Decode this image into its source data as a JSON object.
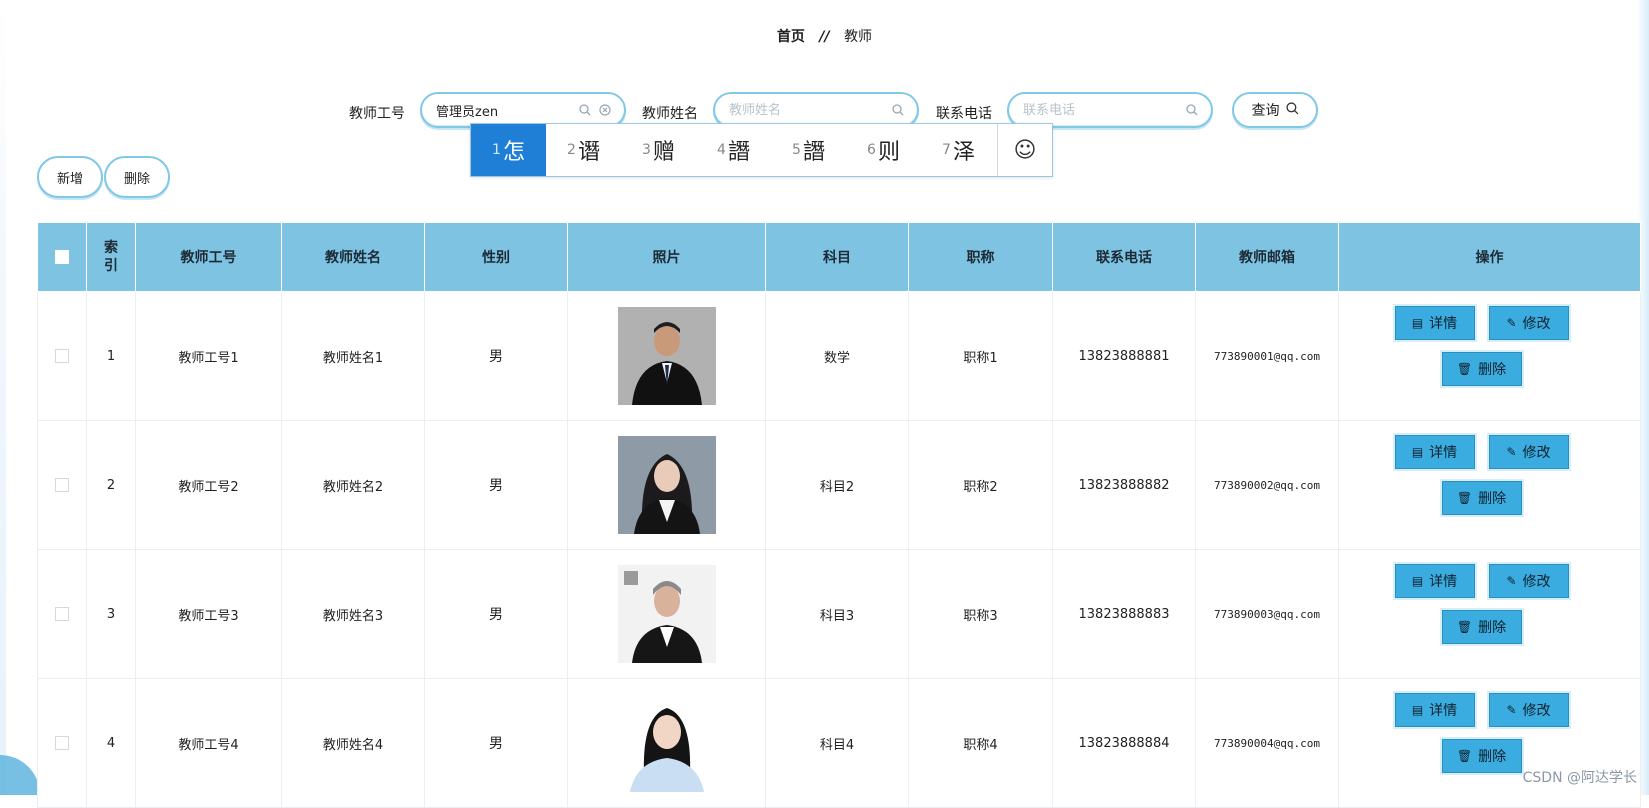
{
  "breadcrumb": {
    "home": "首页",
    "separator": "//",
    "current": "教师"
  },
  "search": {
    "teacher_no": {
      "label": "教师工号",
      "value": "管理员zen",
      "placeholder": ""
    },
    "teacher_name": {
      "label": "教师姓名",
      "value": "",
      "placeholder": "教师姓名"
    },
    "phone": {
      "label": "联系电话",
      "value": "",
      "placeholder": "联系电话"
    },
    "query_label": "查询"
  },
  "ime": {
    "candidates": [
      {
        "num": "1",
        "char": "怎"
      },
      {
        "num": "2",
        "char": "谮"
      },
      {
        "num": "3",
        "char": "赠"
      },
      {
        "num": "4",
        "char": "譖"
      },
      {
        "num": "5",
        "char": "譖"
      },
      {
        "num": "6",
        "char": "则"
      },
      {
        "num": "7",
        "char": "泽"
      }
    ],
    "emoji": "☺"
  },
  "actions": {
    "add": "新增",
    "delete": "删除"
  },
  "table": {
    "headers": [
      "索引",
      "教师工号",
      "教师姓名",
      "性别",
      "照片",
      "科目",
      "职称",
      "联系电话",
      "教师邮箱",
      "操作"
    ],
    "index_header_lines": [
      "索",
      "引"
    ],
    "rows": [
      {
        "index": "1",
        "teacher_no": "教师工号1",
        "name": "教师姓名1",
        "gender": "男",
        "subject": "数学",
        "title": "职称1",
        "phone": "13823888881",
        "email": "773890001@qq.com"
      },
      {
        "index": "2",
        "teacher_no": "教师工号2",
        "name": "教师姓名2",
        "gender": "男",
        "subject": "科目2",
        "title": "职称2",
        "phone": "13823888882",
        "email": "773890002@qq.com"
      },
      {
        "index": "3",
        "teacher_no": "教师工号3",
        "name": "教师姓名3",
        "gender": "男",
        "subject": "科目3",
        "title": "职称3",
        "phone": "13823888883",
        "email": "773890003@qq.com"
      },
      {
        "index": "4",
        "teacher_no": "教师工号4",
        "name": "教师姓名4",
        "gender": "男",
        "subject": "科目4",
        "title": "职称4",
        "phone": "13823888884",
        "email": "773890004@qq.com"
      }
    ],
    "row_actions": {
      "detail": "详情",
      "edit": "修改",
      "delete": "删除"
    }
  },
  "watermark": "CSDN @阿达学长",
  "colors": {
    "header_bg": "#7ec3e2",
    "accent": "#3aace0",
    "ime_active": "#1f7fd6",
    "pill_border": "#80c8e6"
  },
  "icons": [
    "search-icon",
    "clear-icon",
    "document-icon",
    "pencil-icon",
    "trash-icon",
    "smile-icon"
  ]
}
